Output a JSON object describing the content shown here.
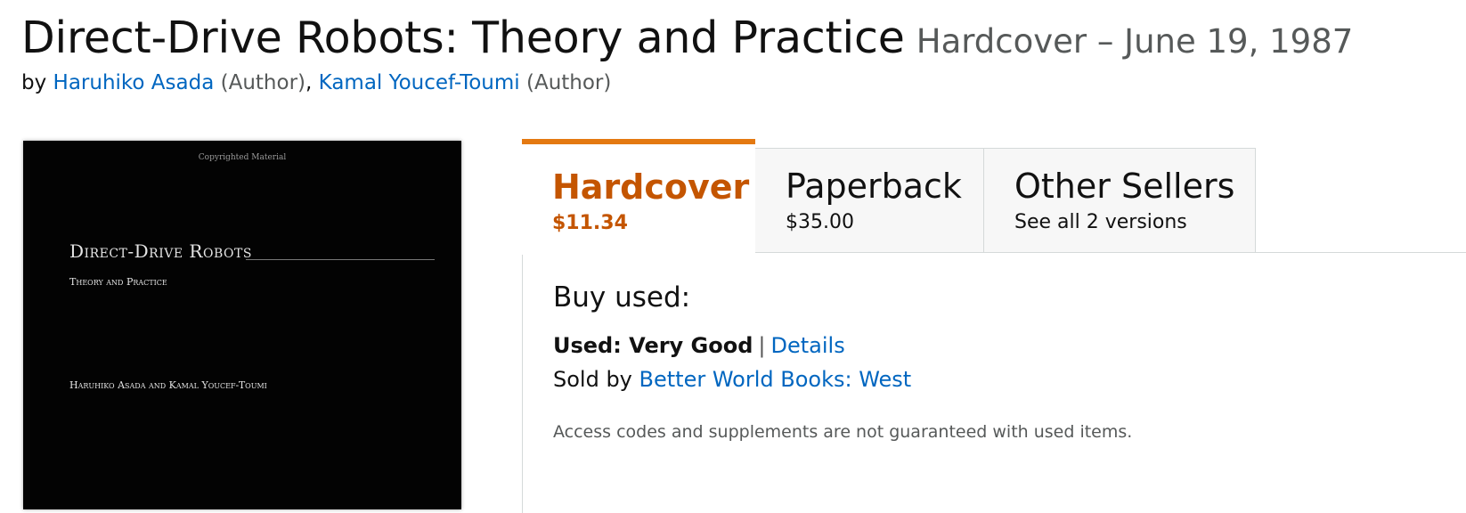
{
  "product": {
    "title": "Direct-Drive Robots: Theory and Practice",
    "format_date": "Hardcover – June 19, 1987",
    "by_label": "by",
    "authors": [
      {
        "name": "Haruhiko Asada",
        "role": "(Author)",
        "separator": ","
      },
      {
        "name": "Kamal Youcef-Toumi",
        "role": "(Author)",
        "separator": ""
      }
    ]
  },
  "cover": {
    "copyright": "Copyrighted Material",
    "title": "Direct-Drive Robots",
    "subtitle": "Theory and Practice",
    "authors": "Haruhiko Asada and Kamal Youcef-Toumi"
  },
  "tabs": [
    {
      "label": "Hardcover",
      "sub": "$11.34",
      "active": true
    },
    {
      "label": "Paperback",
      "sub": "$35.00",
      "active": false
    },
    {
      "label": "Other Sellers",
      "sub": "See all 2 versions",
      "active": false
    }
  ],
  "buy": {
    "heading": "Buy used:",
    "condition_label": "Used: Very Good",
    "separator": "|",
    "details_link": "Details",
    "sold_by_label": "Sold by",
    "seller": "Better World Books: West",
    "note": "Access codes and supplements are not guaranteed with used items."
  },
  "colors": {
    "link": "#0066c0",
    "active_tab_accent": "#e47911",
    "active_tab_text": "#c45500",
    "muted_text": "#565959"
  }
}
